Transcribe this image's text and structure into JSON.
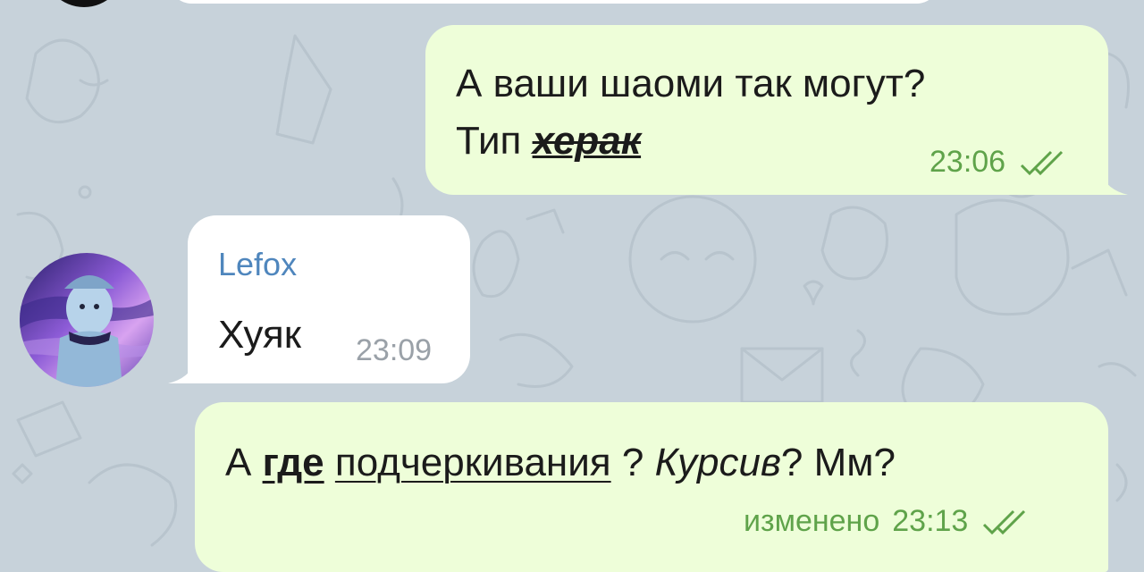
{
  "colors": {
    "background": "#c7d2da",
    "outgoing_bubble": "#eefed9",
    "incoming_bubble": "#ffffff",
    "outgoing_meta": "#5fa34a",
    "incoming_meta": "#9aa1a8",
    "sender_name": "#4f86bd"
  },
  "messages": [
    {
      "direction": "outgoing",
      "line1": "А ваши шаоми так могут?",
      "line2_prefix": "Тип ",
      "line2_formatted": "херак",
      "time": "23:06",
      "status_icon": "double-check-icon"
    },
    {
      "direction": "incoming",
      "sender": "Lefox",
      "text": "Хуяк",
      "time": "23:09",
      "avatar_icon": "anime-avatar"
    },
    {
      "direction": "outgoing",
      "parts": {
        "p1": "А ",
        "p2_bold_underline": "где",
        "p3": " ",
        "p4_underline": "подчеркивания",
        "p5": " ? ",
        "p6_italic": "Курсив",
        "p7": "? Мм?"
      },
      "edited_label": "изменено",
      "time": "23:13",
      "status_icon": "double-check-icon"
    }
  ]
}
